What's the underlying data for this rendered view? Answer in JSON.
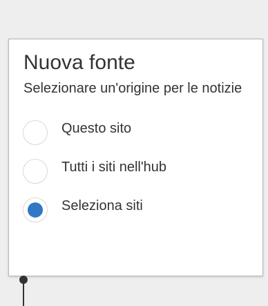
{
  "panel": {
    "title": "Nuova fonte",
    "subtitle": "Selezionare un'origine per le notizie",
    "options": [
      {
        "label": "Questo sito",
        "selected": false
      },
      {
        "label": "Tutti i siti nell'hub",
        "selected": false
      },
      {
        "label": "Seleziona siti",
        "selected": true
      }
    ]
  },
  "colors": {
    "accent": "#2f78c4",
    "background": "#eeeeee",
    "panel": "#ffffff",
    "text": "#333333"
  }
}
